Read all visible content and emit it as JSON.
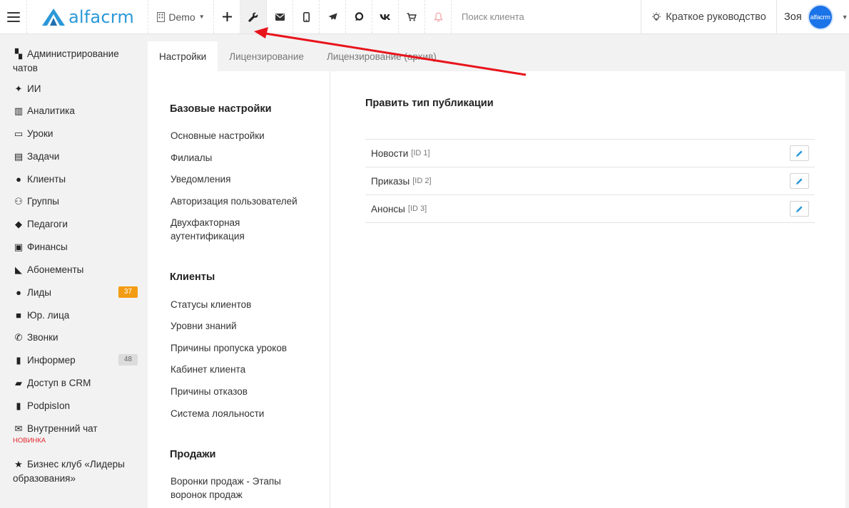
{
  "header": {
    "logo_text": "alfacrm",
    "account_label": "Demo",
    "search": {
      "placeholder": "Поиск клиента",
      "value": ""
    },
    "guide_label": "Краткое руководство",
    "user_name": "Зоя",
    "avatar_text": "alfacrm",
    "toolbar_icons": [
      "plus-icon",
      "wrench-icon",
      "envelope-icon",
      "mobile-icon",
      "telegram-icon",
      "chat-icon",
      "vk-icon",
      "cart-icon",
      "bell-icon"
    ]
  },
  "sidebar": {
    "items": [
      {
        "label": "Администрирование чатов",
        "icon": "chats-icon"
      },
      {
        "label": "ИИ",
        "icon": "sparkle-icon"
      },
      {
        "label": "Аналитика",
        "icon": "map-icon"
      },
      {
        "label": "Уроки",
        "icon": "calendar-icon"
      },
      {
        "label": "Задачи",
        "icon": "clipboard-icon"
      },
      {
        "label": "Клиенты",
        "icon": "user-icon"
      },
      {
        "label": "Группы",
        "icon": "users-icon"
      },
      {
        "label": "Педагоги",
        "icon": "graduation-cap-icon"
      },
      {
        "label": "Финансы",
        "icon": "money-icon"
      },
      {
        "label": "Абонементы",
        "icon": "tag-icon"
      },
      {
        "label": "Лиды",
        "icon": "user-plus-icon",
        "badge": "37"
      },
      {
        "label": "Юр. лица",
        "icon": "briefcase-icon"
      },
      {
        "label": "Звонки",
        "icon": "phone-icon"
      },
      {
        "label": "Информер",
        "icon": "book-icon",
        "badge": "48"
      },
      {
        "label": "Доступ в CRM",
        "icon": "lock-icon"
      },
      {
        "label": "PodpisIon",
        "icon": "file-icon"
      },
      {
        "label": "Внутренний чат",
        "icon": "envelope-icon",
        "sub": "НОВИНКА"
      },
      {
        "label": "Бизнес клуб «Лидеры образования»",
        "icon": "star-icon"
      }
    ],
    "badge_colors": {
      "leads": "#f39c12",
      "informer": "#dcdcdc"
    }
  },
  "tabs": [
    {
      "label": "Настройки",
      "active": true
    },
    {
      "label": "Лицензирование",
      "active": false
    },
    {
      "label": "Лицензирование (архив)",
      "active": false
    }
  ],
  "settings_nav": {
    "groups": [
      {
        "title": "Базовые настройки",
        "links": [
          "Основные настройки",
          "Филиалы",
          "Уведомления",
          "Авторизация пользователей",
          "Двухфакторная аутентификация"
        ]
      },
      {
        "title": "Клиенты",
        "links": [
          "Статусы клиентов",
          "Уровни знаний",
          "Причины пропуска уроков",
          "Кабинет клиента",
          "Причины отказов",
          "Система лояльности"
        ]
      },
      {
        "title": "Продажи",
        "links": [
          "Воронки продаж - Этапы воронок продаж"
        ]
      }
    ]
  },
  "main": {
    "title": "Править тип публикации",
    "rows": [
      {
        "name": "Новости",
        "id": "[ID 1]"
      },
      {
        "name": "Приказы",
        "id": "[ID 2]"
      },
      {
        "name": "Анонсы",
        "id": "[ID 3]"
      }
    ]
  },
  "colors": {
    "brand": "#2a98d8",
    "annotation_arrow": "#e8141c",
    "new_label": "#e2242a"
  }
}
